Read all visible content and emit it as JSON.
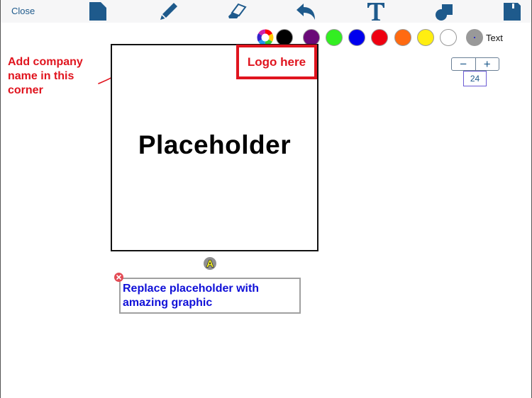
{
  "toolbar": {
    "close_label": "Close",
    "tools": [
      {
        "name": "new-page",
        "icon": "document-icon"
      },
      {
        "name": "pencil",
        "icon": "pencil-icon"
      },
      {
        "name": "eraser",
        "icon": "eraser-icon"
      },
      {
        "name": "undo",
        "icon": "undo-icon"
      },
      {
        "name": "text",
        "icon": "text-t-icon"
      },
      {
        "name": "shapes",
        "icon": "shapes-icon"
      },
      {
        "name": "save",
        "icon": "floppy-disk-icon"
      }
    ],
    "icon_color": "#1e5a8c"
  },
  "palette": {
    "colors": [
      {
        "name": "custom-color-wheel",
        "hex": "rainbow"
      },
      {
        "name": "black",
        "hex": "#000000"
      },
      {
        "name": "purple",
        "hex": "#6a0a78"
      },
      {
        "name": "green",
        "hex": "#33ee22"
      },
      {
        "name": "blue",
        "hex": "#0000ee"
      },
      {
        "name": "red",
        "hex": "#ee0011"
      },
      {
        "name": "orange",
        "hex": "#ff6a11"
      },
      {
        "name": "yellow",
        "hex": "#ffee11"
      },
      {
        "name": "white",
        "hex": "#ffffff"
      }
    ],
    "selected_brush": {
      "hex": "#999999"
    },
    "mode_label": "Text"
  },
  "size_stepper": {
    "decrement_label": "−",
    "increment_label": "+",
    "value": "24"
  },
  "canvas": {
    "annotation_left": "Add company name in this corner",
    "placeholder_text": "Placeholder",
    "logo_text": "Logo here",
    "handle_label": "A",
    "active_textbox": "Replace placeholder with amazing graphic",
    "annotation_color": "#e0141e",
    "textbox_color": "#1010d8"
  }
}
